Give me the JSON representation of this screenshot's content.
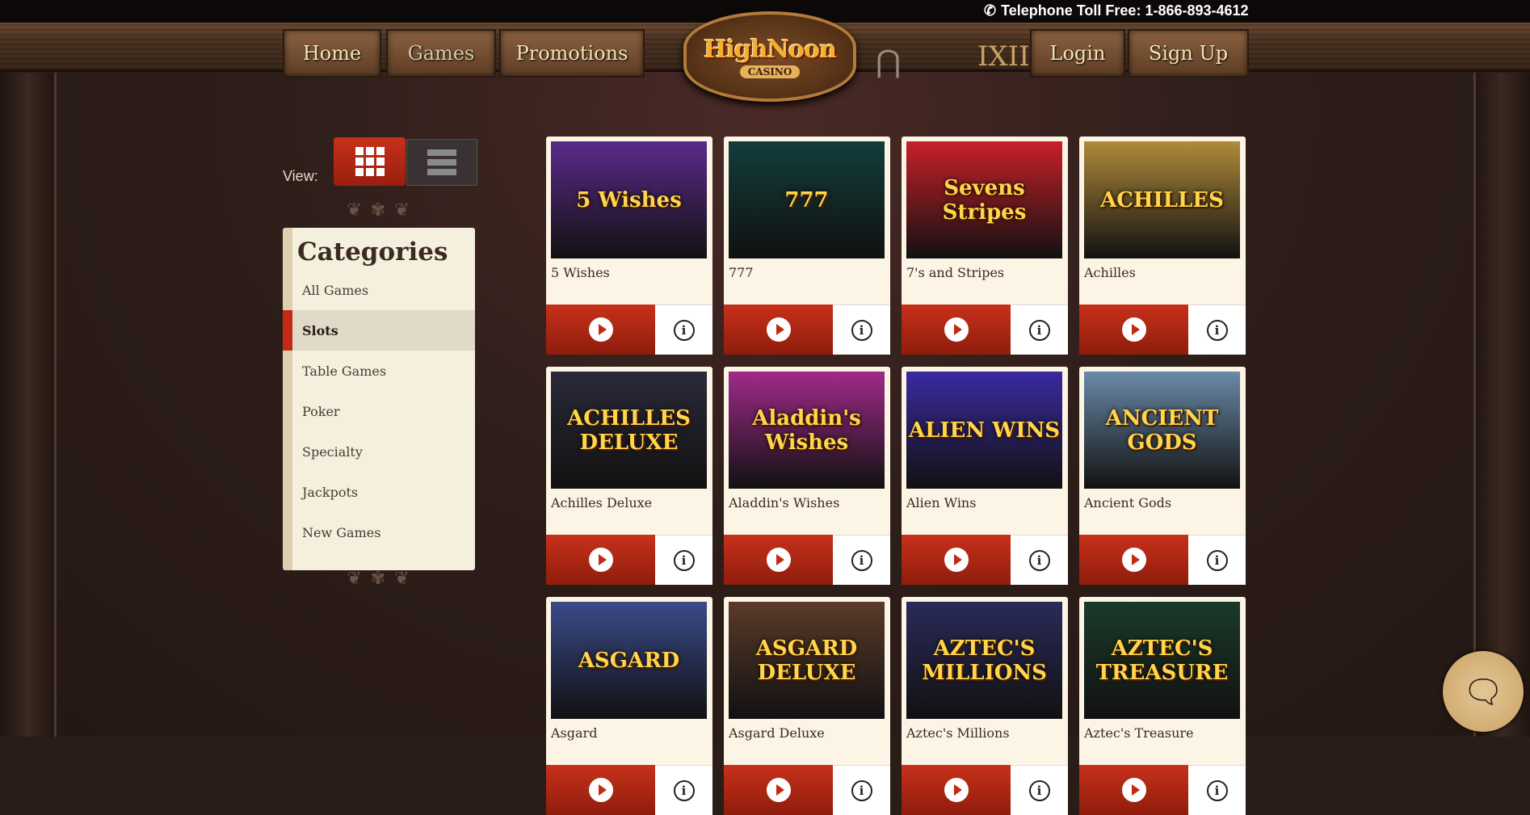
{
  "header": {
    "phone_label": "Telephone Toll Free: 1-866-893-4612",
    "nav_left": [
      {
        "label": "Home"
      },
      {
        "label": "Games"
      },
      {
        "label": "Promotions"
      }
    ],
    "nav_right": [
      {
        "label": "Login"
      },
      {
        "label": "Sign Up"
      }
    ],
    "logo_text": "HighNoon",
    "logo_sub": "CASINO",
    "clock_text": "IXII"
  },
  "view": {
    "label": "View:",
    "selected": "grid"
  },
  "categories": {
    "title": "Categories",
    "items": [
      {
        "label": "All Games",
        "active": false
      },
      {
        "label": "Slots",
        "active": true
      },
      {
        "label": "Table Games",
        "active": false
      },
      {
        "label": "Poker",
        "active": false
      },
      {
        "label": "Specialty",
        "active": false
      },
      {
        "label": "Jackpots",
        "active": false
      },
      {
        "label": "New Games",
        "active": false
      }
    ]
  },
  "games": [
    {
      "name": "5 Wishes",
      "art": "5 Wishes",
      "bg": "#5a2a8a"
    },
    {
      "name": "777",
      "art": "777",
      "bg": "#123c3a"
    },
    {
      "name": "7's and Stripes",
      "art": "Sevens Stripes",
      "bg": "#c8202a"
    },
    {
      "name": "Achilles",
      "art": "ACHILLES",
      "bg": "#b08a3a"
    },
    {
      "name": "Achilles Deluxe",
      "art": "ACHILLES DELUXE",
      "bg": "#2a2a3a"
    },
    {
      "name": "Aladdin's Wishes",
      "art": "Aladdin's Wishes",
      "bg": "#a02a8a"
    },
    {
      "name": "Alien Wins",
      "art": "ALIEN WINS",
      "bg": "#3a2aa0"
    },
    {
      "name": "Ancient Gods",
      "art": "ANCIENT GODS",
      "bg": "#6a8aa8"
    },
    {
      "name": "Asgard",
      "art": "ASGARD",
      "bg": "#3a4a8a"
    },
    {
      "name": "Asgard Deluxe",
      "art": "ASGARD DELUXE",
      "bg": "#5a3a2a"
    },
    {
      "name": "Aztec's Millions",
      "art": "AZTEC'S MILLIONS",
      "bg": "#2a2a5a"
    },
    {
      "name": "Aztec's Treasure",
      "art": "AZTEC'S TREASURE",
      "bg": "#1a3a2a"
    }
  ],
  "chat": {
    "icon": "chat-icon"
  }
}
